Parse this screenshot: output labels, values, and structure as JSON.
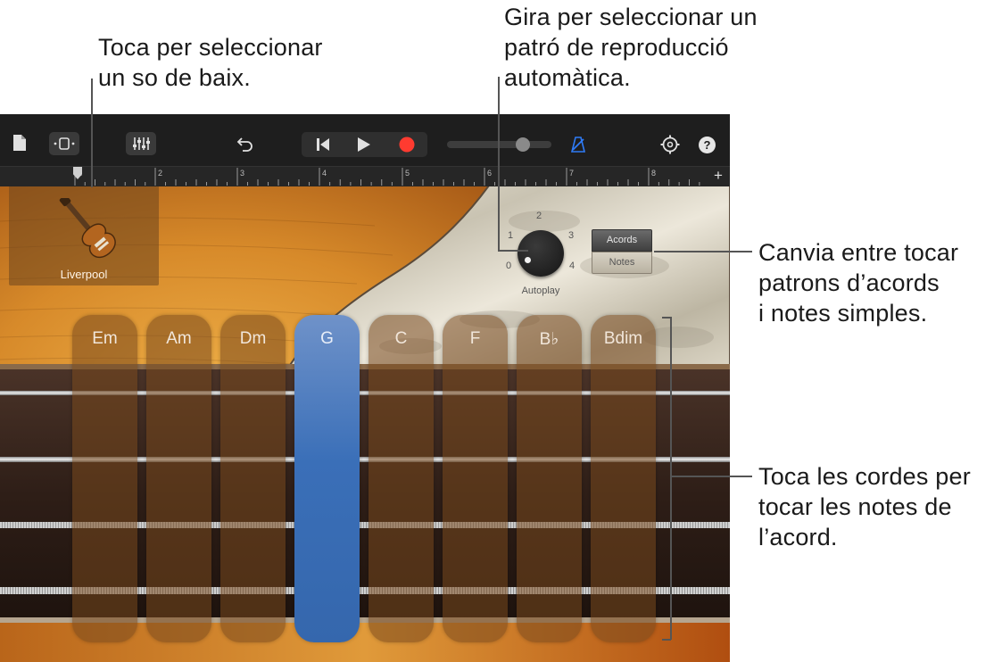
{
  "callouts": {
    "bass_sound": [
      "Toca per seleccionar",
      "un so de baix."
    ],
    "autoplay": [
      "Gira per seleccionar un",
      "patró de reproducció",
      "automàtica."
    ],
    "chords_notes": [
      "Canvia entre tocar",
      "patrons d’acords",
      "i notes simples."
    ],
    "strings": [
      "Toca les cordes per",
      "tocar les notes de",
      "l’acord."
    ]
  },
  "toolbar": {
    "icons": [
      "my-songs-icon",
      "browser-icon",
      "mixer-icon",
      "undo-icon",
      "go-to-beginning-icon",
      "play-icon",
      "record-icon",
      "volume-slider",
      "metronome-icon",
      "settings-icon",
      "help-icon"
    ],
    "help_label": "?",
    "volume_level": 0.73
  },
  "ruler": {
    "bars": [
      "1",
      "2",
      "3",
      "4",
      "5",
      "6",
      "7",
      "8"
    ],
    "add_label": "+"
  },
  "instrument": {
    "name": "Liverpool"
  },
  "autoplay": {
    "label": "Autoplay",
    "positions": [
      "0",
      "1",
      "2",
      "3",
      "4"
    ],
    "selected": "0"
  },
  "mode_switch": {
    "chords": "Acords",
    "notes": "Notes",
    "selected": "Acords"
  },
  "chords": [
    {
      "label": "Em",
      "active": false
    },
    {
      "label": "Am",
      "active": false
    },
    {
      "label": "Dm",
      "active": false
    },
    {
      "label": "G",
      "active": true
    },
    {
      "label": "C",
      "active": false
    },
    {
      "label": "F",
      "active": false
    },
    {
      "label": "B♭",
      "active": false
    },
    {
      "label": "Bdim",
      "active": false
    }
  ],
  "colors": {
    "accent_blue": "#3a6fb8",
    "record_red": "#ff3b30",
    "metronome_blue": "#2f7bf6"
  }
}
